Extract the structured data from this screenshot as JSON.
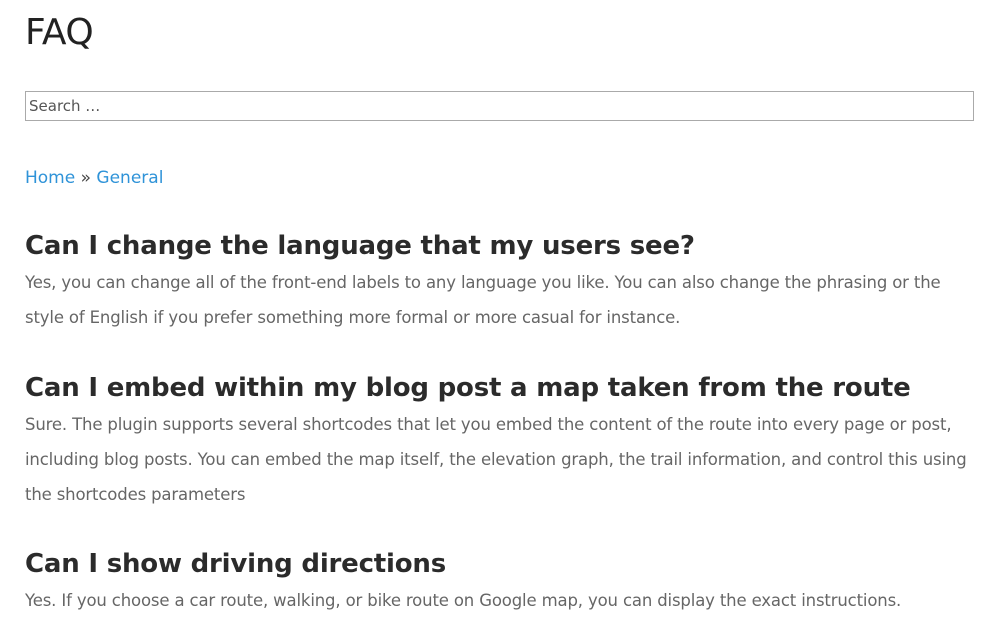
{
  "page": {
    "title": "FAQ"
  },
  "search": {
    "placeholder": "Search …"
  },
  "breadcrumb": {
    "home_label": "Home",
    "separator": "»",
    "current_label": "General"
  },
  "faqs": [
    {
      "question": "Can I change the language that my users see?",
      "answer": "Yes, you can change all of the front-end labels to any language you like. You can also change the phrasing or the style of English if you prefer something more formal or more casual for instance."
    },
    {
      "question": "Can I embed within my blog post a map taken from the route",
      "answer": "Sure. The plugin supports several shortcodes that let you embed the content of the route into every page or post, including blog posts. You can embed the map itself, the elevation graph, the trail information, and control this using the shortcodes parameters"
    },
    {
      "question": "Can I show driving directions",
      "answer": "Yes. If you choose a car route, walking, or bike route on Google map, you can display the exact instructions."
    }
  ],
  "colors": {
    "link": "#2f93d8",
    "heading": "#2b2b2b",
    "body_text": "#666666",
    "input_border": "#aaaaaa"
  }
}
